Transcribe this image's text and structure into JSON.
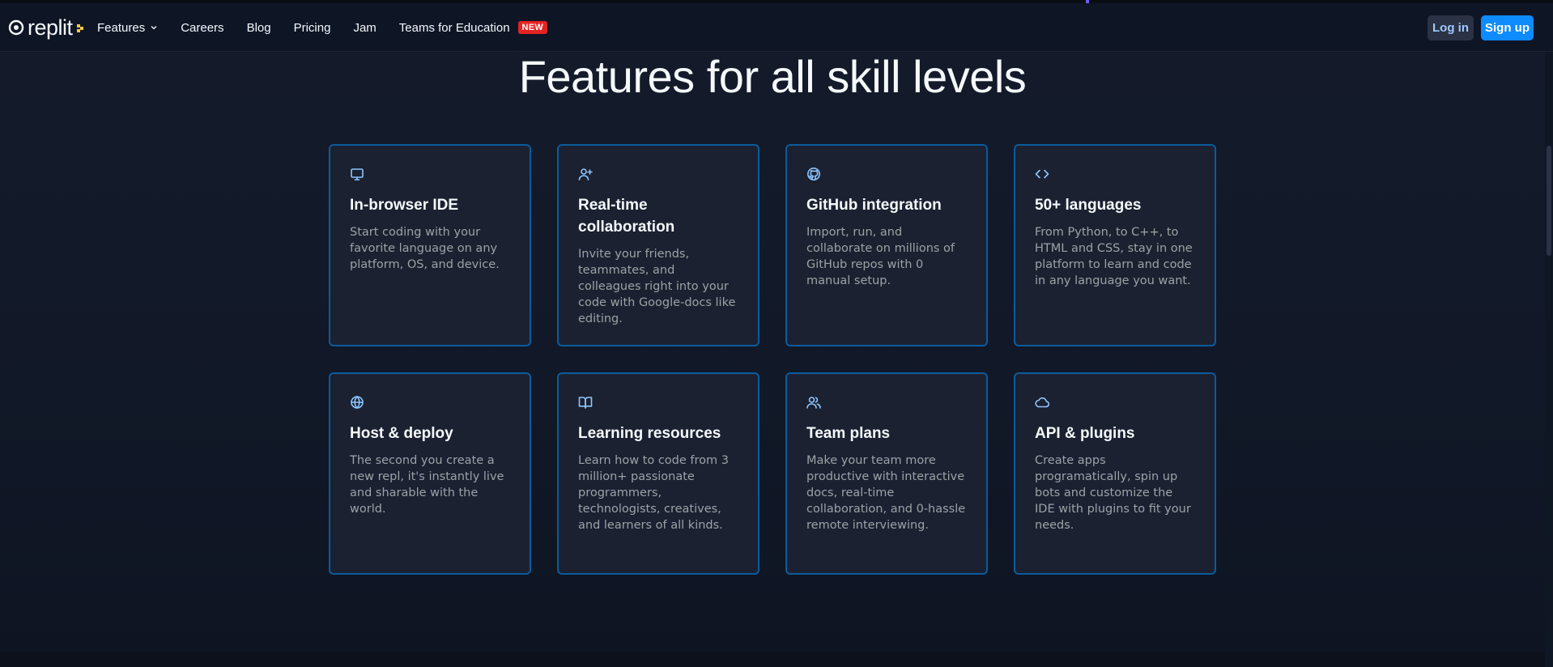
{
  "brand": {
    "name": "replit"
  },
  "nav": {
    "items": [
      {
        "label": "Features",
        "has_dropdown": true
      },
      {
        "label": "Careers"
      },
      {
        "label": "Blog"
      },
      {
        "label": "Pricing"
      },
      {
        "label": "Jam"
      },
      {
        "label": "Teams for Education",
        "badge": "NEW"
      }
    ],
    "login_label": "Log in",
    "signup_label": "Sign up"
  },
  "hero": {
    "title": "Features for all skill levels"
  },
  "features": [
    {
      "icon": "monitor-icon",
      "title": "In-browser IDE",
      "description": "Start coding with your favorite language on any platform, OS, and device."
    },
    {
      "icon": "user-plus-icon",
      "title": "Real-time collaboration",
      "description": "Invite your friends, teammates, and colleagues right into your code with Google-docs like editing."
    },
    {
      "icon": "github-icon",
      "title": "GitHub integration",
      "description": "Import, run, and collaborate on millions of GitHub repos with 0 manual setup."
    },
    {
      "icon": "code-icon",
      "title": "50+ languages",
      "description": "From Python, to C++, to HTML and CSS, stay in one platform to learn and code in any language you want."
    },
    {
      "icon": "globe-icon",
      "title": "Host & deploy",
      "description": "The second you create a new repl, it's instantly live and sharable with the world."
    },
    {
      "icon": "book-open-icon",
      "title": "Learning resources",
      "description": "Learn how to code from 3 million+ passionate programmers, technologists, creatives, and learners of all kinds."
    },
    {
      "icon": "users-icon",
      "title": "Team plans",
      "description": "Make your team more productive with interactive docs, real-time collaboration, and 0-hassle remote interviewing."
    },
    {
      "icon": "cloud-icon",
      "title": "API & plugins",
      "description": "Create apps programatically, spin up bots and customize the IDE with plugins to fit your needs."
    }
  ],
  "colors": {
    "background": "#111827",
    "card_border": "#0b5b9c",
    "accent_blue": "#0d8bff",
    "badge_red": "#e52222",
    "icon_blue": "#8ec6ff"
  }
}
